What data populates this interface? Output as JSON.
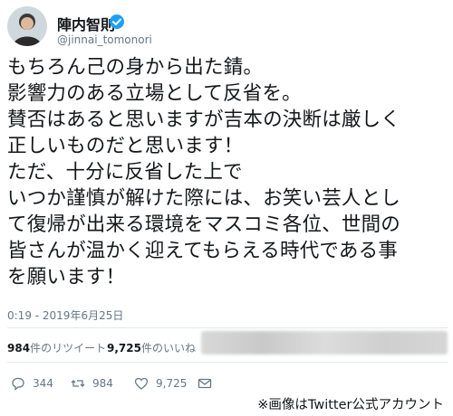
{
  "user": {
    "name": "陣内智則",
    "handle": "@jinnai_tomonori",
    "verified": true
  },
  "tweet": {
    "lines": [
      "もちろん己の身から出た錆。",
      "影響力のある立場として反省を。",
      "賛否はあると思いますが吉本の決断は厳しく",
      "正しいものだと思います！",
      "ただ、十分に反省した上で",
      "いつか謹慎が解けた際には、お笑い芸人とし",
      "て復帰が出来る環境をマスコミ各位、世間の",
      "皆さんが温かく迎えてもらえる時代である事",
      "を願います！"
    ],
    "timestamp": "0:19 - 2019年6月25日"
  },
  "stats": {
    "retweets_num": "984",
    "retweets_label": "件のリツイート",
    "likes_num": "9,725",
    "likes_label": "件のいいね"
  },
  "actions": {
    "replies": "344",
    "retweets": "984",
    "likes": "9,725"
  },
  "caption": "※画像はTwitter公式アカウント",
  "colors": {
    "verified": "#1da1f2",
    "secondary_text": "#657786",
    "divider": "#e1e8ed"
  }
}
